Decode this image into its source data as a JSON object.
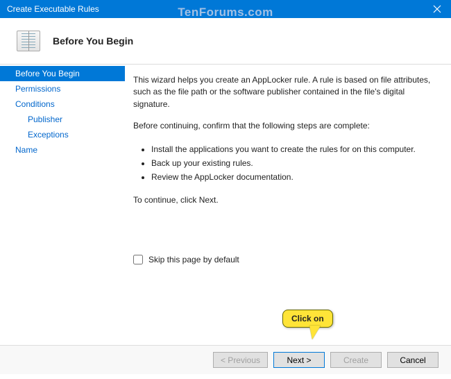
{
  "window": {
    "title": "Create Executable Rules",
    "watermark": "TenForums.com"
  },
  "header": {
    "title": "Before You Begin"
  },
  "sidebar": {
    "items": [
      {
        "label": "Before You Begin",
        "selected": true,
        "sub": false
      },
      {
        "label": "Permissions",
        "selected": false,
        "sub": false
      },
      {
        "label": "Conditions",
        "selected": false,
        "sub": false
      },
      {
        "label": "Publisher",
        "selected": false,
        "sub": true
      },
      {
        "label": "Exceptions",
        "selected": false,
        "sub": true
      },
      {
        "label": "Name",
        "selected": false,
        "sub": false
      }
    ]
  },
  "content": {
    "intro": "This wizard helps you create an AppLocker rule. A rule is based on file attributes, such as the file path or the software publisher contained in the file's digital signature.",
    "confirm": "Before continuing, confirm that the following steps are complete:",
    "bullets": [
      "Install the applications you want to create the rules for on this computer.",
      "Back up your existing rules.",
      "Review the AppLocker documentation."
    ],
    "continue": "To continue, click Next.",
    "skip_label": "Skip this page by default"
  },
  "footer": {
    "previous": "< Previous",
    "next": "Next >",
    "create": "Create",
    "cancel": "Cancel"
  },
  "callout": {
    "text": "Click on"
  }
}
